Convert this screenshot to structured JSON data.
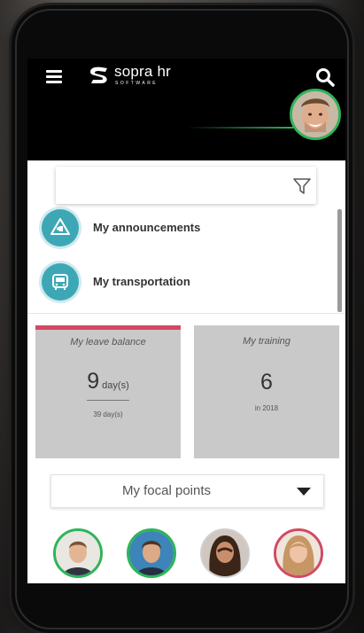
{
  "header": {
    "logo_text": "sopra hr",
    "logo_subtext": "SOFTWARE",
    "menu_icon": "hamburger-icon",
    "search_icon": "search-icon"
  },
  "search": {
    "placeholder": "",
    "value": "",
    "filter_icon": "filter-icon"
  },
  "menu_items": [
    {
      "label": "My announcements",
      "icon": "megaphone-icon"
    },
    {
      "label": "My transportation",
      "icon": "bus-icon"
    }
  ],
  "cards": {
    "leave": {
      "title": "My leave balance",
      "value": "9",
      "unit": "day(s)",
      "sub": "39 day(s)"
    },
    "training": {
      "title": "My training",
      "value": "6",
      "sub": "in 2018"
    }
  },
  "focal": {
    "label": "My focal points",
    "caret_icon": "caret-down-icon"
  },
  "colors": {
    "accent_green": "#2fb45a",
    "accent_pink": "#d14a63",
    "icon_teal": "#3ea7b5",
    "card_gray": "#c9c9c9",
    "header_black": "#000000"
  }
}
